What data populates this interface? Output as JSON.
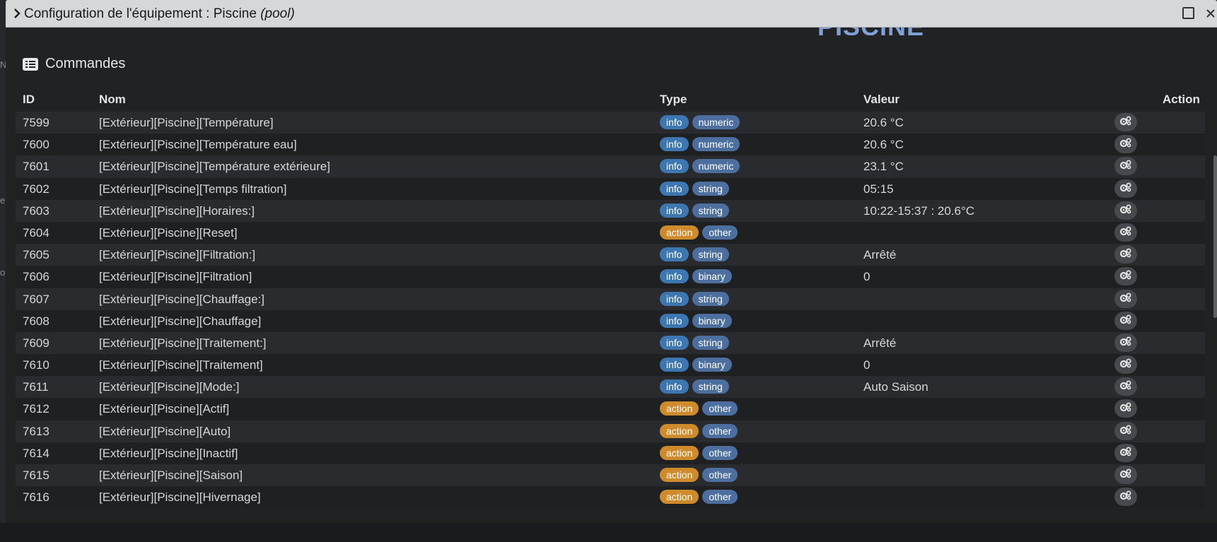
{
  "window": {
    "title_prefix": "Configuration de l'équipement : Piscine ",
    "title_equipment": "(pool)"
  },
  "background": {
    "heading": "PISCINE",
    "side_letters": [
      "N",
      "e",
      "o"
    ]
  },
  "section": {
    "title": "Commandes",
    "icon": "list-icon"
  },
  "table": {
    "headers": {
      "id": "ID",
      "name": "Nom",
      "type": "Type",
      "value": "Valeur",
      "action": "Action"
    },
    "rows": [
      {
        "id": "7599",
        "name": "[Extérieur][Piscine][Température]",
        "type": "info",
        "subtype": "numeric",
        "value": "20.6 °C"
      },
      {
        "id": "7600",
        "name": "[Extérieur][Piscine][Température eau]",
        "type": "info",
        "subtype": "numeric",
        "value": "20.6 °C"
      },
      {
        "id": "7601",
        "name": "[Extérieur][Piscine][Température extérieure]",
        "type": "info",
        "subtype": "numeric",
        "value": "23.1 °C"
      },
      {
        "id": "7602",
        "name": "[Extérieur][Piscine][Temps filtration]",
        "type": "info",
        "subtype": "string",
        "value": "05:15"
      },
      {
        "id": "7603",
        "name": "[Extérieur][Piscine][Horaires:]",
        "type": "info",
        "subtype": "string",
        "value": "10:22-15:37 : 20.6°C"
      },
      {
        "id": "7604",
        "name": "[Extérieur][Piscine][Reset]",
        "type": "action",
        "subtype": "other",
        "value": ""
      },
      {
        "id": "7605",
        "name": "[Extérieur][Piscine][Filtration:]",
        "type": "info",
        "subtype": "string",
        "value": "Arrêté"
      },
      {
        "id": "7606",
        "name": "[Extérieur][Piscine][Filtration]",
        "type": "info",
        "subtype": "binary",
        "value": "0"
      },
      {
        "id": "7607",
        "name": "[Extérieur][Piscine][Chauffage:]",
        "type": "info",
        "subtype": "string",
        "value": ""
      },
      {
        "id": "7608",
        "name": "[Extérieur][Piscine][Chauffage]",
        "type": "info",
        "subtype": "binary",
        "value": ""
      },
      {
        "id": "7609",
        "name": "[Extérieur][Piscine][Traitement:]",
        "type": "info",
        "subtype": "string",
        "value": "Arrêté"
      },
      {
        "id": "7610",
        "name": "[Extérieur][Piscine][Traitement]",
        "type": "info",
        "subtype": "binary",
        "value": "0"
      },
      {
        "id": "7611",
        "name": "[Extérieur][Piscine][Mode:]",
        "type": "info",
        "subtype": "string",
        "value": "Auto Saison"
      },
      {
        "id": "7612",
        "name": "[Extérieur][Piscine][Actif]",
        "type": "action",
        "subtype": "other",
        "value": ""
      },
      {
        "id": "7613",
        "name": "[Extérieur][Piscine][Auto]",
        "type": "action",
        "subtype": "other",
        "value": ""
      },
      {
        "id": "7614",
        "name": "[Extérieur][Piscine][Inactif]",
        "type": "action",
        "subtype": "other",
        "value": ""
      },
      {
        "id": "7615",
        "name": "[Extérieur][Piscine][Saison]",
        "type": "action",
        "subtype": "other",
        "value": ""
      },
      {
        "id": "7616",
        "name": "[Extérieur][Piscine][Hivernage]",
        "type": "action",
        "subtype": "other",
        "value": ""
      }
    ]
  },
  "colors": {
    "info_badge": "#3d77b1",
    "action_badge": "#cf8a2c",
    "subtype_badge": "#4d6f9f",
    "titlebar": "#d6d7d8"
  }
}
